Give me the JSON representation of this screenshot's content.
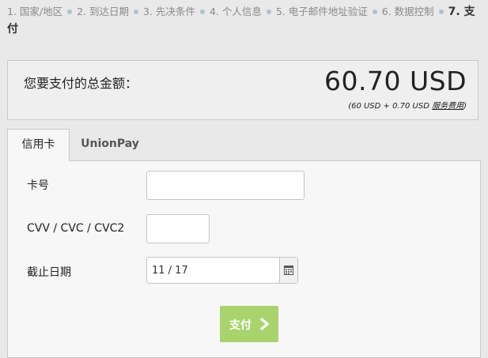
{
  "steps": [
    {
      "label": "1. 国家/地区"
    },
    {
      "label": "2. 到达日期"
    },
    {
      "label": "3. 先决条件"
    },
    {
      "label": "4. 个人信息"
    },
    {
      "label": "5. 电子邮件地址验证"
    },
    {
      "label": "6. 数据控制"
    },
    {
      "label": "7. 支付"
    }
  ],
  "total": {
    "label": "您要支付的总金额：",
    "amount": "60.70 USD",
    "breakdown_prefix": "(60 USD + 0.70 USD ",
    "fee_link": "服务费用",
    "breakdown_suffix": ")"
  },
  "tabs": [
    {
      "label": "信用卡",
      "active": true
    },
    {
      "label": "UnionPay",
      "active": false
    }
  ],
  "form": {
    "card_number_label": "卡号",
    "card_number_value": "",
    "cvv_label": "CVV / CVC / CVC2",
    "cvv_value": "",
    "expiry_label": "截止日期",
    "expiry_value": "11 / 17",
    "pay_label": "支付"
  },
  "colors": {
    "step_separator": "#a7c5cc",
    "pay_button": "#a9d36d",
    "background": "#e9e9e9"
  }
}
